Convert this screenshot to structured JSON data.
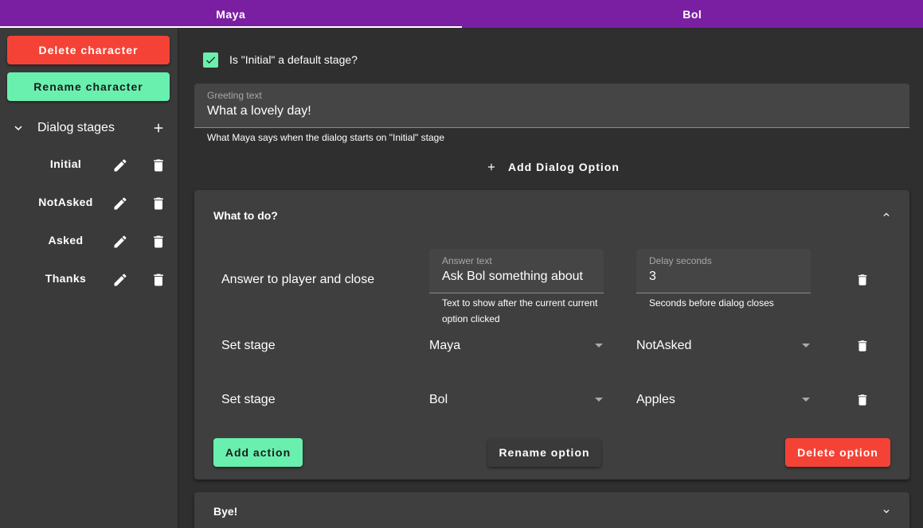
{
  "tabs": [
    {
      "label": "Maya",
      "active": true
    },
    {
      "label": "Bol",
      "active": false
    }
  ],
  "sidebar": {
    "delete_label": "Delete character",
    "rename_label": "Rename character",
    "stages_title": "Dialog stages",
    "stages": [
      {
        "label": "Initial"
      },
      {
        "label": "NotAsked"
      },
      {
        "label": "Asked"
      },
      {
        "label": "Thanks"
      }
    ]
  },
  "main": {
    "default_stage_label": "Is \"Initial\" a default stage?",
    "default_stage_checked": true,
    "greeting": {
      "label": "Greeting text",
      "value": "What a lovely day!",
      "helper": "What Maya says when the dialog starts on \"Initial\" stage"
    },
    "add_dialog_label": "Add Dialog Option",
    "options": [
      {
        "title": "What to do?",
        "expanded": true,
        "actions": [
          {
            "label": "Answer to player and close",
            "answer_label": "Answer text",
            "answer_value": "Ask Bol something about",
            "answer_helper": "Text to show after the current current option clicked",
            "delay_label": "Delay seconds",
            "delay_value": "3",
            "delay_helper": "Seconds before dialog closes"
          },
          {
            "label": "Set stage",
            "character": "Maya",
            "stage": "NotAsked"
          },
          {
            "label": "Set stage",
            "character": "Bol",
            "stage": "Apples"
          }
        ],
        "add_action_label": "Add action",
        "rename_option_label": "Rename option",
        "delete_option_label": "Delete option"
      },
      {
        "title": "Bye!",
        "expanded": false
      }
    ]
  },
  "colors": {
    "tab_bar": "#7b1fa2",
    "danger": "#f44336",
    "accent": "#69f0ae",
    "background": "#2f2f2f",
    "panel": "#3f3f3f"
  }
}
